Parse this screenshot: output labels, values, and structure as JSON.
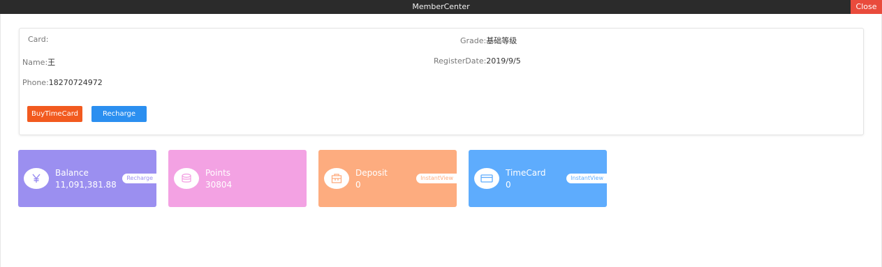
{
  "window": {
    "title": "MemberCenter",
    "close_label": "Close"
  },
  "member": {
    "card_label": "Card:",
    "card_value": "",
    "grade_label": "Grade:",
    "grade_value": "基础等级",
    "name_label": "Name:",
    "name_value": "王",
    "register_label": "RegisterDate:",
    "register_value": "2019/9/5",
    "phone_label": "Phone:",
    "phone_value": "18270724972"
  },
  "actions": {
    "buy_time_card": "BuyTimeCard",
    "recharge": "Recharge"
  },
  "cards": {
    "balance": {
      "label": "Balance",
      "value": "11,091,381.88",
      "action": "Recharge",
      "icon": "yen-icon",
      "color": "#9b8ff0"
    },
    "points": {
      "label": "Points",
      "value": "30804",
      "icon": "coins-icon",
      "color": "#f3a2e3"
    },
    "deposit": {
      "label": "Deposit",
      "value": "0",
      "action": "InstantView",
      "icon": "box-icon",
      "color": "#fdac7f"
    },
    "timecard": {
      "label": "TimeCard",
      "value": "0",
      "action": "InstantView",
      "icon": "card-icon",
      "color": "#5eacfd"
    }
  }
}
